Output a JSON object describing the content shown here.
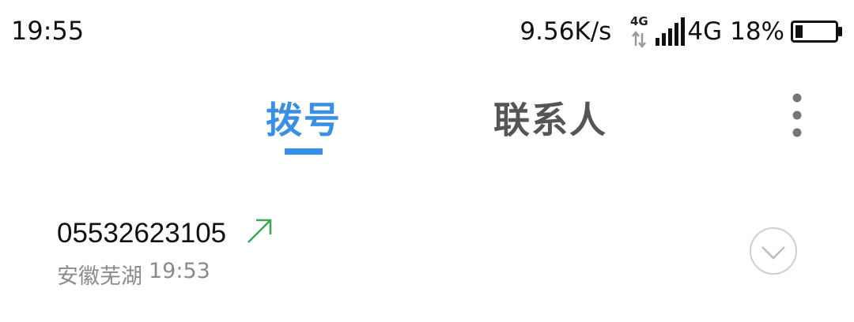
{
  "status_bar": {
    "time": "19:55",
    "net_speed": "9.56K/s",
    "net_type_small": "4G",
    "net_type": "4G",
    "battery_percent": "18%",
    "battery_level": 0.18,
    "signal_bars": 5
  },
  "tabs": [
    {
      "label": "拨号",
      "active": true
    },
    {
      "label": "联系人",
      "active": false
    }
  ],
  "colors": {
    "accent": "#3b8fe0",
    "outgoing_arrow": "#3fa65a",
    "secondary_text": "#8a8a8a"
  },
  "call_log": [
    {
      "number": "05532623105",
      "location": "安徽芜湖",
      "time": "19:53",
      "direction": "outgoing",
      "direction_icon": "outgoing-arrow-icon",
      "expand_icon": "chevron-down-circle-icon"
    }
  ]
}
